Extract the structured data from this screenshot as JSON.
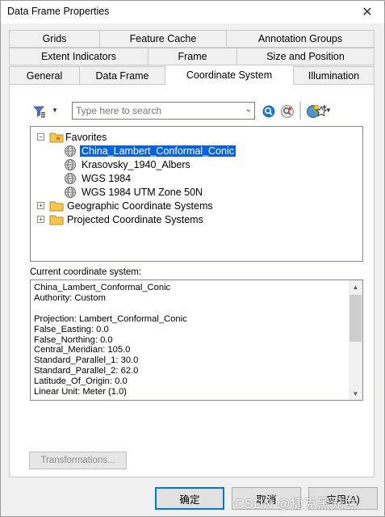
{
  "window": {
    "title": "Data Frame Properties",
    "close_glyph": "✕"
  },
  "tabs": {
    "row1": [
      "Grids",
      "Feature Cache",
      "Annotation Groups"
    ],
    "row2": [
      "Extent Indicators",
      "Frame",
      "Size and Position"
    ],
    "row3": [
      "General",
      "Data Frame",
      "Coordinate System",
      "Illumination"
    ],
    "active": "Coordinate System"
  },
  "toolbar": {
    "search_placeholder": "Type here to search",
    "icons": [
      "filter-icon",
      "search-icon",
      "clear-search-icon",
      "globe-icon",
      "add-favorite-icon"
    ]
  },
  "tree": {
    "favorites": {
      "label": "Favorites",
      "expanded_glyph": "−",
      "items": [
        {
          "label": "China_Lambert_Conformal_Conic",
          "selected": true
        },
        {
          "label": "Krasovsky_1940_Albers",
          "selected": false
        },
        {
          "label": "WGS 1984",
          "selected": false
        },
        {
          "label": "WGS 1984 UTM Zone 50N",
          "selected": false
        }
      ]
    },
    "folders": [
      {
        "label": "Geographic Coordinate Systems",
        "collapsed_glyph": "+"
      },
      {
        "label": "Projected Coordinate Systems",
        "collapsed_glyph": "+"
      }
    ]
  },
  "current": {
    "label": "Current coordinate system:",
    "lines": [
      "China_Lambert_Conformal_Conic",
      "Authority: Custom",
      "",
      "Projection: Lambert_Conformal_Conic",
      "False_Easting: 0.0",
      "False_Northing: 0.0",
      "Central_Meridian: 105.0",
      "Standard_Parallel_1: 30.0",
      "Standard_Parallel_2: 62.0",
      "Latitude_Of_Origin: 0.0",
      "Linear Unit: Meter (1.0)"
    ]
  },
  "buttons": {
    "transformations": "Transformations...",
    "ok": "确定",
    "cancel": "取消",
    "apply": "应用(A)"
  },
  "watermark": "CSDN @捷克黑兄兰",
  "colors": {
    "selection": "#0a64d8",
    "default_border": "#0078d7"
  }
}
